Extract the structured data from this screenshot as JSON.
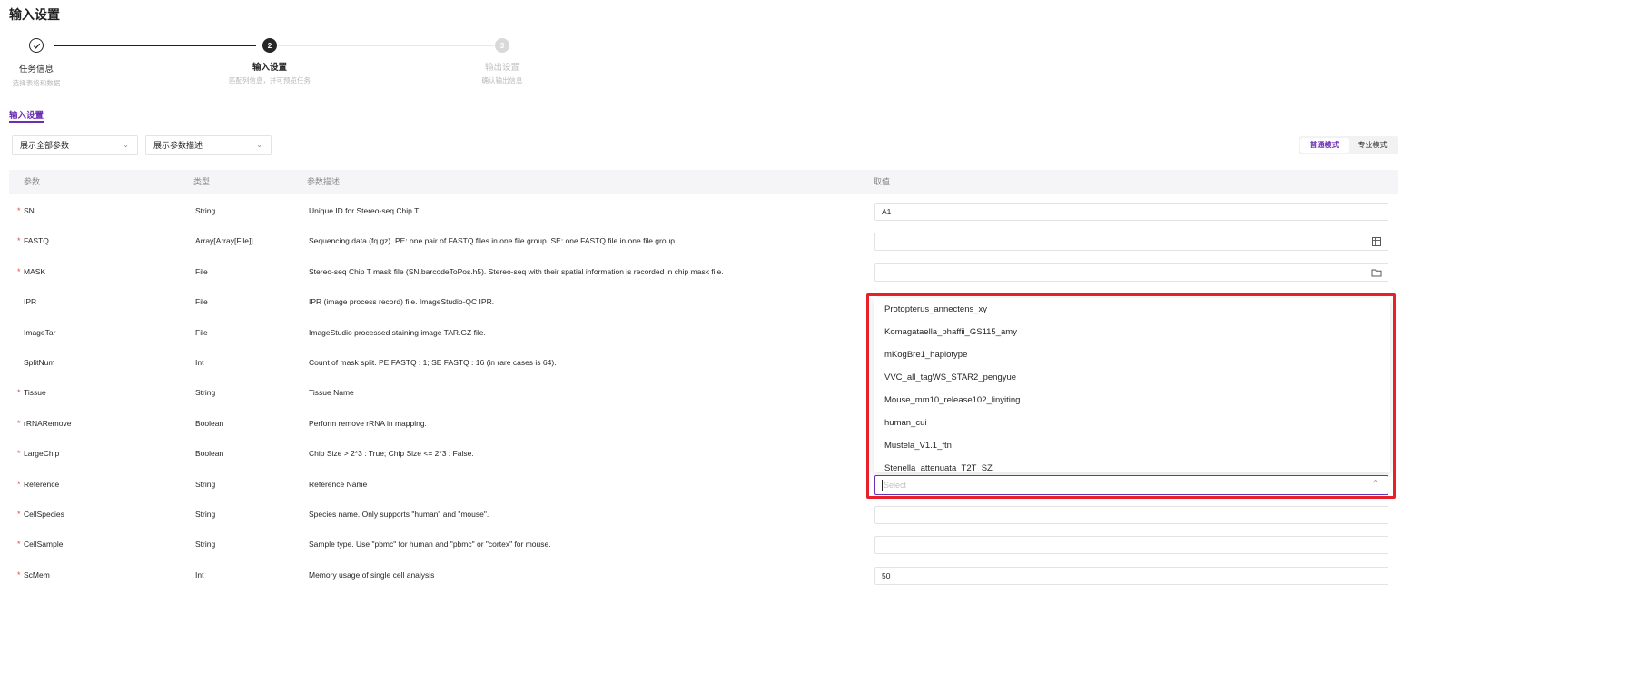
{
  "page": {
    "title": "输入设置"
  },
  "steps": [
    {
      "title": "任务信息",
      "desc": "选择表格和数据",
      "status": "finish",
      "icon": "check-icon"
    },
    {
      "title": "输入设置",
      "desc": "匹配列信息，并可预览任务",
      "status": "process",
      "number": "2"
    },
    {
      "title": "输出设置",
      "desc": "确认输出信息",
      "status": "wait",
      "number": "3"
    }
  ],
  "tab": {
    "label": "输入设置"
  },
  "filters": {
    "params": {
      "value": "展示全部参数"
    },
    "desc": {
      "value": "展示参数描述"
    }
  },
  "mode": {
    "normal": "普通模式",
    "expert": "专业模式",
    "active": "普通模式"
  },
  "table": {
    "headers": {
      "param": "参数",
      "type": "类型",
      "desc": "参数描述",
      "value": "取值"
    },
    "rows": [
      {
        "required": "*",
        "param": "SN",
        "type": "String",
        "desc": "Unique ID for Stereo-seq Chip T.",
        "value": "A1"
      },
      {
        "required": "*",
        "param": "FASTQ",
        "type": "Array[Array[File]]",
        "desc": "Sequencing data (fq.gz). PE: one pair of FASTQ files in one file group. SE: one FASTQ file in one file group.",
        "value": "",
        "icon": "table-icon"
      },
      {
        "required": "*",
        "param": "MASK",
        "type": "File",
        "desc": "Stereo-seq Chip T mask file (SN.barcodeToPos.h5). Stereo-seq with their spatial information is recorded in chip mask file.",
        "value": "",
        "icon": "folder-icon"
      },
      {
        "required": "",
        "param": "IPR",
        "type": "File",
        "desc": "IPR (image process record) file. ImageStudio-QC IPR."
      },
      {
        "required": "",
        "param": "ImageTar",
        "type": "File",
        "desc": "ImageStudio processed staining image TAR.GZ file."
      },
      {
        "required": "",
        "param": "SplitNum",
        "type": "Int",
        "desc": "Count of mask split. PE FASTQ : 1; SE FASTQ : 16 (in rare cases is 64)."
      },
      {
        "required": "*",
        "param": "Tissue",
        "type": "String",
        "desc": "Tissue Name"
      },
      {
        "required": "*",
        "param": "rRNARemove",
        "type": "Boolean",
        "desc": "Perform remove rRNA in mapping."
      },
      {
        "required": "*",
        "param": "LargeChip",
        "type": "Boolean",
        "desc": "Chip Size > 2*3 : True; Chip Size <= 2*3 : False."
      },
      {
        "required": "*",
        "param": "Reference",
        "type": "String",
        "desc": "Reference Name"
      },
      {
        "required": "*",
        "param": "CellSpecies",
        "type": "String",
        "desc": "Species name. Only supports \"human\" and \"mouse\".",
        "value": ""
      },
      {
        "required": "*",
        "param": "CellSample",
        "type": "String",
        "desc": "Sample type. Use \"pbmc\" for human and \"pbmc\" or \"cortex\" for mouse.",
        "value": ""
      },
      {
        "required": "*",
        "param": "ScMem",
        "type": "Int",
        "desc": "Memory usage of single cell analysis",
        "value": "50"
      }
    ]
  },
  "reference_select": {
    "placeholder": "Select",
    "options": [
      "Protopterus_annectens_xy",
      "Komagataella_phaffii_GS115_amy",
      "mKogBre1_haplotype",
      "VVC_all_tagWS_STAR2_pengyue",
      "Mouse_mm10_release102_linyiting",
      "human_cui",
      "Mustela_V1.1_ftn",
      "Stenella_attenuata_T2T_SZ"
    ]
  },
  "colors": {
    "accent": "#6b2fb3",
    "required": "#e5484d",
    "highlight": "#e8202a"
  }
}
